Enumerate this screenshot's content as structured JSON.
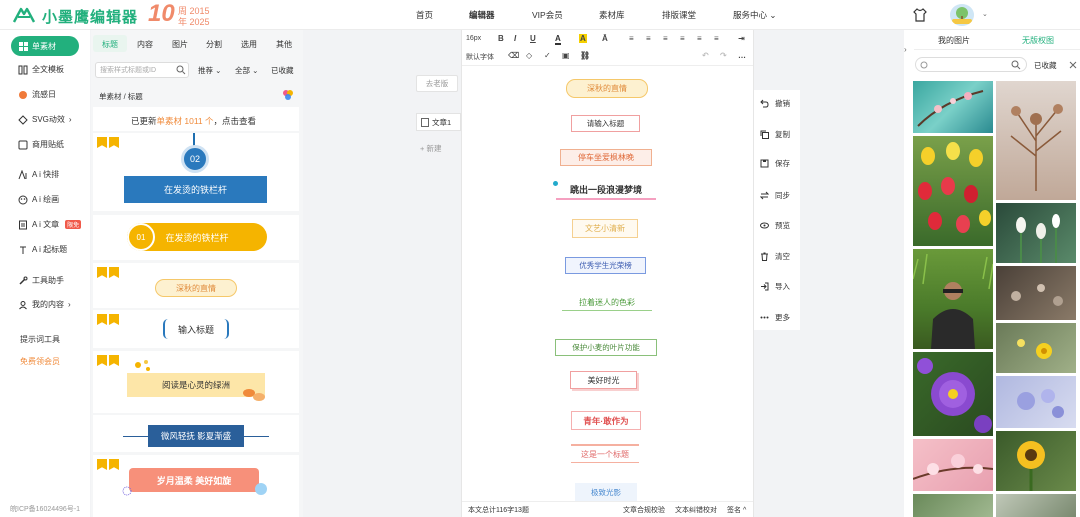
{
  "header": {
    "logo_text": "小墨鹰编辑器",
    "anniv_number": "10",
    "anniv_line1": "周 2015",
    "anniv_line2": "年 2025",
    "nav": [
      "首页",
      "编辑器",
      "VIP会员",
      "素材库",
      "排版课堂",
      "服务中心"
    ],
    "service_caret": "⌄",
    "avatar_caret": "⌄",
    "colors": {
      "brand": "#22b07d",
      "anniv": "#f08a6a"
    }
  },
  "sidebar": {
    "items": [
      {
        "label": "单素材",
        "icon": "grid-icon"
      },
      {
        "label": "全文模板",
        "icon": "template-icon"
      },
      {
        "label": "流感日",
        "icon": "sun-icon"
      },
      {
        "label": "SVG动效",
        "suffix": "›",
        "icon": "svg-icon"
      },
      {
        "label": "商用贴纸",
        "icon": "sticker-icon"
      },
      {
        "label": "A i 快排",
        "icon": "ai-icon"
      },
      {
        "label": "A i 绘画",
        "icon": "palette-icon"
      },
      {
        "label": "A i 文章",
        "badge": "限免",
        "icon": "article-icon"
      },
      {
        "label": "A i 起标题",
        "icon": "title-icon"
      },
      {
        "label": "工具助手",
        "icon": "tools-icon"
      },
      {
        "label": "我的内容",
        "suffix": "›",
        "icon": "user-icon"
      },
      {
        "label": "提示词工具"
      },
      {
        "label": "免费领会员"
      }
    ],
    "icp": "皖ICP备16024496号-1"
  },
  "materials": {
    "tabs": [
      "标题",
      "内容",
      "图片",
      "分割",
      "选用",
      "其他"
    ],
    "active_tab": "标题",
    "search_placeholder": "搜索样式标题或ID",
    "filters": [
      "推荐",
      "全部",
      "已收藏"
    ],
    "filter_caret": "⌄",
    "breadcrumb": "单素材 / 标题",
    "update_prefix": "已更新",
    "update_highlight": "单素材 1011 个",
    "update_suffix": "，点击查看",
    "cards": [
      "在发烫的铁栏杆",
      "在发烫的铁栏杆",
      "深秋的直情",
      "输入标题",
      "阅读是心灵的绿洲",
      "微风轻抚 影夏渐盛",
      "岁月温柔 美好如旋"
    ],
    "card_numbers": [
      "02",
      "01"
    ]
  },
  "editor": {
    "back_label": "去老版",
    "doc_label": "文章1",
    "new_label": "新建",
    "font_size": "16px",
    "font_family": "默认字体",
    "toolbar_glyphs": [
      "B",
      "I",
      "U",
      "A",
      "A",
      "Ā",
      "≡",
      "≡",
      "≡",
      "≡",
      "≡",
      "≡",
      "⇥",
      "⌫",
      "◇",
      "✓",
      "▣",
      "⛓",
      "↶",
      "↷",
      "…"
    ],
    "templates": [
      "深秋的直情",
      "请输入标题",
      "停车坐爱枫林晚",
      "跳出一段浪漫梦境",
      "文艺小清新",
      "优秀学生光荣榜",
      "拉着迷人的色彩",
      "保护小麦的叶片功能",
      "美好时光",
      "青年·敢作为",
      "这是一个标题",
      "极致光影"
    ],
    "status_left": "本文总计116字13题",
    "status_items": [
      "文章合规校验",
      "文本纠错校对",
      "签名"
    ],
    "status_caret": "^"
  },
  "actions": [
    {
      "label": "撤销",
      "icon": "undo-icon"
    },
    {
      "label": "复制",
      "icon": "copy-icon"
    },
    {
      "label": "保存",
      "icon": "save-icon"
    },
    {
      "label": "同步",
      "icon": "sync-icon"
    },
    {
      "label": "预览",
      "icon": "eye-icon"
    },
    {
      "label": "清空",
      "icon": "trash-icon"
    },
    {
      "label": "导入",
      "icon": "import-icon"
    },
    {
      "label": "更多",
      "icon": "more-icon"
    }
  ],
  "right_panel": {
    "tabs": [
      "我的图片",
      "无版权图"
    ],
    "active_tab": "无版权图",
    "arrow": "›",
    "fav_label": "已收藏",
    "photos": [
      "teal-blossom",
      "dry-plant",
      "tulips",
      "snowdrops",
      "man-in-grass",
      "seed-heads",
      "purple-primrose",
      "yellow-flower",
      "pink-blossom",
      "lilac-blossom",
      "sunflower",
      "pink-flowers"
    ]
  }
}
